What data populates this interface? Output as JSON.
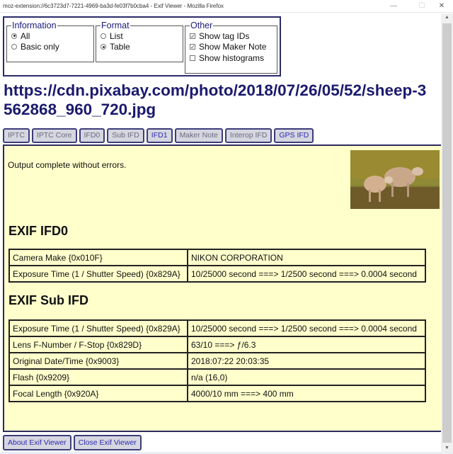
{
  "window": {
    "title": "moz-extension://6c3723d7-7221-4969-ba3d-fe03f7b0cba4 - Exif Viewer - Mozilla Firefox",
    "minimize_icon": "minimize-icon",
    "maximize_icon": "maximize-icon",
    "close_icon": "close-icon",
    "minimize_glyph": "—",
    "maximize_glyph": "☐",
    "close_glyph": "✕"
  },
  "options": {
    "information": {
      "legend": "Information",
      "items": [
        {
          "label": "All",
          "selected": true
        },
        {
          "label": "Basic only",
          "selected": false
        }
      ]
    },
    "format": {
      "legend": "Format",
      "items": [
        {
          "label": "List",
          "selected": false
        },
        {
          "label": "Table",
          "selected": true
        }
      ]
    },
    "other": {
      "legend": "Other",
      "items": [
        {
          "label": "Show tag IDs",
          "checked": true
        },
        {
          "label": "Show Maker Note",
          "checked": true
        },
        {
          "label": "Show histograms",
          "checked": false
        }
      ]
    }
  },
  "heading": "https://cdn.pixabay.com/photo/2018/07/26/05/52/sheep-3562868_960_720.jpg",
  "tabs": [
    {
      "label": "IPTC",
      "active": false
    },
    {
      "label": "IPTC Core",
      "active": false
    },
    {
      "label": "IFD0",
      "active": false
    },
    {
      "label": "Sub IFD",
      "active": false
    },
    {
      "label": "IFD1",
      "active": true
    },
    {
      "label": "Maker Note",
      "active": false
    },
    {
      "label": "Interop IFD",
      "active": false
    },
    {
      "label": "GPS IFD",
      "active": true
    }
  ],
  "panel": {
    "status": "Output complete without errors.",
    "thumbnail_alt": "sheep photo thumbnail",
    "sections": [
      {
        "title": "EXIF IFD0",
        "rows": [
          {
            "key": "Camera Make {0x010F}",
            "value": "NIKON CORPORATION"
          },
          {
            "key": "Exposure Time (1 / Shutter Speed) {0x829A}",
            "value": "10/25000 second ===> 1/2500 second ===> 0.0004 second"
          }
        ]
      },
      {
        "title": "EXIF Sub IFD",
        "rows": [
          {
            "key": "Exposure Time (1 / Shutter Speed) {0x829A}",
            "value": "10/25000 second ===> 1/2500 second ===> 0.0004 second"
          },
          {
            "key": "Lens F-Number / F-Stop {0x829D}",
            "value": "63/10 ===> ƒ/6.3"
          },
          {
            "key": "Original Date/Time {0x9003}",
            "value": "2018:07:22 20:03:35"
          },
          {
            "key": "Flash {0x9209}",
            "value": "n/a (16,0)"
          },
          {
            "key": "Focal Length {0x920A}",
            "value": "4000/10 mm ===> 400 mm"
          }
        ]
      }
    ]
  },
  "footer": {
    "about_label": "About Exif Viewer",
    "close_label": "Close Exif Viewer"
  },
  "scrollbar": {
    "up_glyph": "▲",
    "down_glyph": "▼"
  },
  "colors": {
    "heading": "#1a1a6e",
    "panel_bg": "#ffffcc",
    "tab_bg": "#d6d6e0",
    "tab_active_text": "#2b2bb0",
    "border": "#2b2b5e"
  }
}
